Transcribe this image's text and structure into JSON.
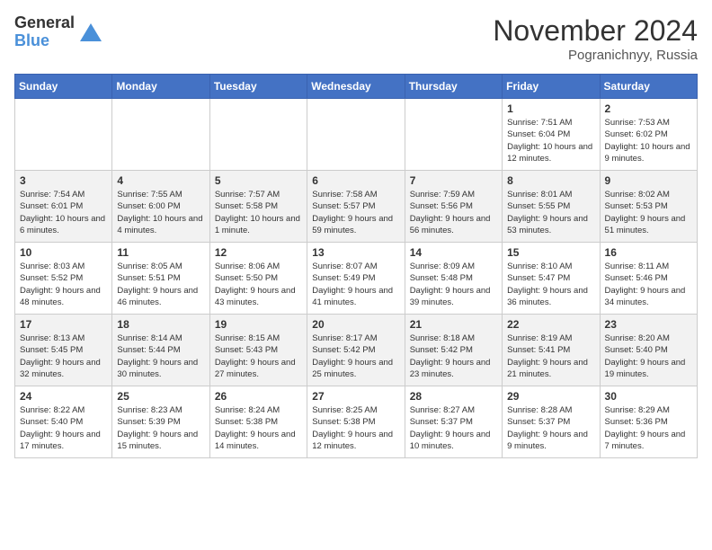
{
  "header": {
    "logo_general": "General",
    "logo_blue": "Blue",
    "month_title": "November 2024",
    "location": "Pogranichnyy, Russia"
  },
  "weekdays": [
    "Sunday",
    "Monday",
    "Tuesday",
    "Wednesday",
    "Thursday",
    "Friday",
    "Saturday"
  ],
  "weeks": [
    [
      {
        "day": "",
        "info": ""
      },
      {
        "day": "",
        "info": ""
      },
      {
        "day": "",
        "info": ""
      },
      {
        "day": "",
        "info": ""
      },
      {
        "day": "",
        "info": ""
      },
      {
        "day": "1",
        "info": "Sunrise: 7:51 AM\nSunset: 6:04 PM\nDaylight: 10 hours and 12 minutes."
      },
      {
        "day": "2",
        "info": "Sunrise: 7:53 AM\nSunset: 6:02 PM\nDaylight: 10 hours and 9 minutes."
      }
    ],
    [
      {
        "day": "3",
        "info": "Sunrise: 7:54 AM\nSunset: 6:01 PM\nDaylight: 10 hours and 6 minutes."
      },
      {
        "day": "4",
        "info": "Sunrise: 7:55 AM\nSunset: 6:00 PM\nDaylight: 10 hours and 4 minutes."
      },
      {
        "day": "5",
        "info": "Sunrise: 7:57 AM\nSunset: 5:58 PM\nDaylight: 10 hours and 1 minute."
      },
      {
        "day": "6",
        "info": "Sunrise: 7:58 AM\nSunset: 5:57 PM\nDaylight: 9 hours and 59 minutes."
      },
      {
        "day": "7",
        "info": "Sunrise: 7:59 AM\nSunset: 5:56 PM\nDaylight: 9 hours and 56 minutes."
      },
      {
        "day": "8",
        "info": "Sunrise: 8:01 AM\nSunset: 5:55 PM\nDaylight: 9 hours and 53 minutes."
      },
      {
        "day": "9",
        "info": "Sunrise: 8:02 AM\nSunset: 5:53 PM\nDaylight: 9 hours and 51 minutes."
      }
    ],
    [
      {
        "day": "10",
        "info": "Sunrise: 8:03 AM\nSunset: 5:52 PM\nDaylight: 9 hours and 48 minutes."
      },
      {
        "day": "11",
        "info": "Sunrise: 8:05 AM\nSunset: 5:51 PM\nDaylight: 9 hours and 46 minutes."
      },
      {
        "day": "12",
        "info": "Sunrise: 8:06 AM\nSunset: 5:50 PM\nDaylight: 9 hours and 43 minutes."
      },
      {
        "day": "13",
        "info": "Sunrise: 8:07 AM\nSunset: 5:49 PM\nDaylight: 9 hours and 41 minutes."
      },
      {
        "day": "14",
        "info": "Sunrise: 8:09 AM\nSunset: 5:48 PM\nDaylight: 9 hours and 39 minutes."
      },
      {
        "day": "15",
        "info": "Sunrise: 8:10 AM\nSunset: 5:47 PM\nDaylight: 9 hours and 36 minutes."
      },
      {
        "day": "16",
        "info": "Sunrise: 8:11 AM\nSunset: 5:46 PM\nDaylight: 9 hours and 34 minutes."
      }
    ],
    [
      {
        "day": "17",
        "info": "Sunrise: 8:13 AM\nSunset: 5:45 PM\nDaylight: 9 hours and 32 minutes."
      },
      {
        "day": "18",
        "info": "Sunrise: 8:14 AM\nSunset: 5:44 PM\nDaylight: 9 hours and 30 minutes."
      },
      {
        "day": "19",
        "info": "Sunrise: 8:15 AM\nSunset: 5:43 PM\nDaylight: 9 hours and 27 minutes."
      },
      {
        "day": "20",
        "info": "Sunrise: 8:17 AM\nSunset: 5:42 PM\nDaylight: 9 hours and 25 minutes."
      },
      {
        "day": "21",
        "info": "Sunrise: 8:18 AM\nSunset: 5:42 PM\nDaylight: 9 hours and 23 minutes."
      },
      {
        "day": "22",
        "info": "Sunrise: 8:19 AM\nSunset: 5:41 PM\nDaylight: 9 hours and 21 minutes."
      },
      {
        "day": "23",
        "info": "Sunrise: 8:20 AM\nSunset: 5:40 PM\nDaylight: 9 hours and 19 minutes."
      }
    ],
    [
      {
        "day": "24",
        "info": "Sunrise: 8:22 AM\nSunset: 5:40 PM\nDaylight: 9 hours and 17 minutes."
      },
      {
        "day": "25",
        "info": "Sunrise: 8:23 AM\nSunset: 5:39 PM\nDaylight: 9 hours and 15 minutes."
      },
      {
        "day": "26",
        "info": "Sunrise: 8:24 AM\nSunset: 5:38 PM\nDaylight: 9 hours and 14 minutes."
      },
      {
        "day": "27",
        "info": "Sunrise: 8:25 AM\nSunset: 5:38 PM\nDaylight: 9 hours and 12 minutes."
      },
      {
        "day": "28",
        "info": "Sunrise: 8:27 AM\nSunset: 5:37 PM\nDaylight: 9 hours and 10 minutes."
      },
      {
        "day": "29",
        "info": "Sunrise: 8:28 AM\nSunset: 5:37 PM\nDaylight: 9 hours and 9 minutes."
      },
      {
        "day": "30",
        "info": "Sunrise: 8:29 AM\nSunset: 5:36 PM\nDaylight: 9 hours and 7 minutes."
      }
    ]
  ]
}
